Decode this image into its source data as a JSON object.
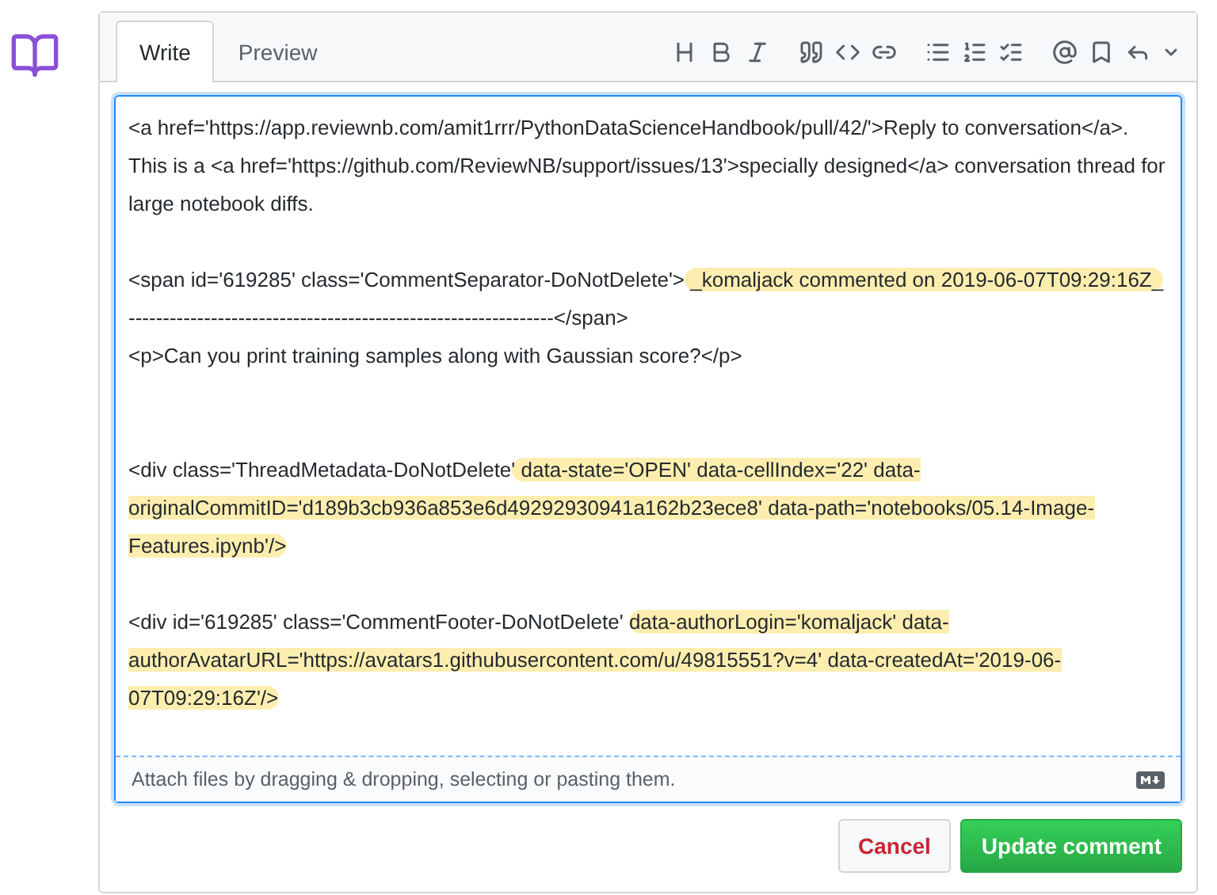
{
  "tabs": [
    {
      "label": "Write",
      "selected": true
    },
    {
      "label": "Preview",
      "selected": false
    }
  ],
  "editor": {
    "blocks": [
      [
        {
          "text": "<a href='https://app.reviewnb.com/amit1rrr/PythonDataScienceHandbook/pull/42/'>Reply to conversation</a>. This is a <a href='https://github.com/ReviewNB/support/issues/13'>specially designed</a> conversation thread for large notebook diffs.",
          "highlighted": false
        }
      ],
      [
        {
          "text": "<span id='619285' class='CommentSeparator-DoNotDelete'>",
          "highlighted": false
        },
        {
          "text": " _komaljack commented on 2019-06-07T09:29:16Z_",
          "highlighted": true
        },
        {
          "text": "\n--------------------------------------------------------------</span>\n<p>Can you print training samples along with Gaussian score?</p>\n\n",
          "highlighted": false
        }
      ],
      [
        {
          "text": "<div class='ThreadMetadata-DoNotDelete",
          "highlighted": false
        },
        {
          "text": "' data-state='OPEN' data-cellIndex='22' data-originalCommitID='d189b3cb936a853e6d49292930941a162b23ece8' data-path='notebooks/05.14-Image-Features.ipynb'/>",
          "highlighted": true
        }
      ],
      [
        {
          "text": "<div id='619285' class='CommentFooter-DoNotDelete' ",
          "highlighted": false
        },
        {
          "text": "data-authorLogin='komaljack' data-authorAvatarURL='https://avatars1.githubusercontent.com/u/49815551?v=4' data-createdAt='2019-06-07T09:29:16Z'/>",
          "highlighted": true
        }
      ]
    ],
    "attach_hint": "Attach files by dragging & dropping, selecting or pasting them."
  },
  "buttons": [
    {
      "label": "Cancel",
      "kind": "cancel"
    },
    {
      "label": "Update comment",
      "kind": "primary"
    }
  ]
}
